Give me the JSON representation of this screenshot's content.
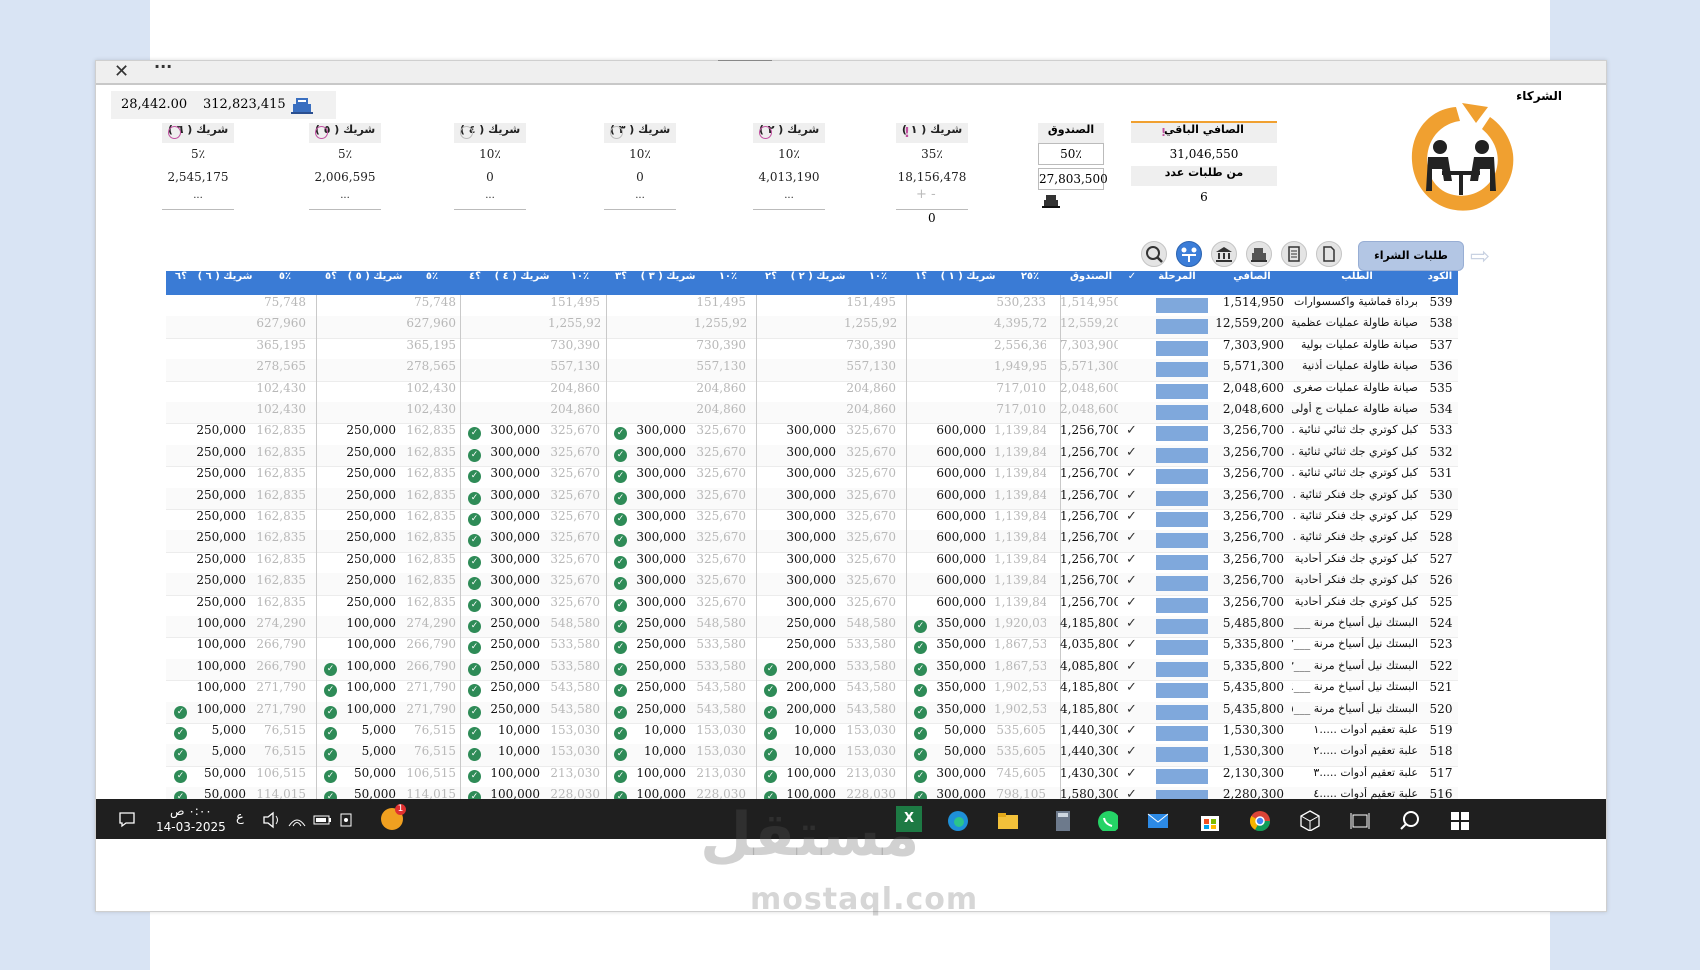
{
  "window": {
    "close_icon": "close-icon",
    "more_label": "···"
  },
  "header": {
    "title": "الشركاء",
    "totals": {
      "value_a": "28,442.00",
      "value_b": "312,823,415"
    },
    "net": {
      "label": "الصافي الباقي",
      "value": "31,046,550",
      "count_label": "من طلبات عدد",
      "count": "6"
    },
    "fund": {
      "label": "الصندوق",
      "percent": "50٪",
      "value": "27,803,500"
    },
    "partners": [
      {
        "label": "شريك ( ١ )",
        "percent": "35٪",
        "value": "18,156,478",
        "extra": "0"
      },
      {
        "label": "شريك ( ٢ )",
        "percent": "10٪",
        "value": "4,013,190",
        "extra": "..."
      },
      {
        "label": "شريك ( ٣ )",
        "percent": "10٪",
        "value": "0",
        "extra": "..."
      },
      {
        "label": "شريك ( ٤ )",
        "percent": "10٪",
        "value": "0",
        "extra": "..."
      },
      {
        "label": "شريك ( ٥ )",
        "percent": "5٪",
        "value": "2,006,595",
        "extra": "..."
      },
      {
        "label": "شريك ( ٦ )",
        "percent": "5٪",
        "value": "2,545,175",
        "extra": "..."
      }
    ],
    "plusminus": "+ -"
  },
  "toolbar": {
    "orders_label": "طلبات الشراء"
  },
  "table": {
    "headers": {
      "code": "الكود",
      "req": "الطلب",
      "net": "الصافي",
      "stage": "المرحلة",
      "chk": "✓",
      "fund": "الصندوق",
      "p1pct": "٪٢٥",
      "p1": "شريك ( ١ )",
      "p1f": "؟١",
      "p2pct": "٪١٠",
      "p2": "شريك ( ٢ )",
      "p2f": "؟٢",
      "p3pct": "٪١٠",
      "p3": "شريك ( ٣ )",
      "p3f": "؟٣",
      "p4pct": "٪١٠",
      "p4": "شريك ( ٤ )",
      "p4f": "؟٤",
      "p5pct": "٪٥",
      "p5": "شريك ( ٥ )",
      "p5f": "؟٥",
      "p6pct": "٪٥",
      "p6": "شريك ( ٦ )",
      "p6f": "؟٦"
    },
    "rows": [
      {
        "code": "539",
        "req": "برداة قماشية واكسسوارات",
        "net": "1,514,950",
        "fund": "1,514,950",
        "p1l": "530,233",
        "p2l": "151,495",
        "p3l": "151,495",
        "p4l": "151,495",
        "p5l": "75,748",
        "p6l": "75,748",
        "light": true
      },
      {
        "code": "538",
        "req": "صيانة طاولة عمليات عظمية",
        "net": "12,559,200",
        "fund": "12,559,200",
        "p1l": "4,395,720",
        "p2l": "1,255,920",
        "p3l": "1,255,920",
        "p4l": "1,255,920",
        "p5l": "627,960",
        "p6l": "627,960",
        "light": true
      },
      {
        "code": "537",
        "req": "صيانة طاولة عمليات بولية",
        "net": "7,303,900",
        "fund": "7,303,900",
        "p1l": "2,556,365",
        "p2l": "730,390",
        "p3l": "730,390",
        "p4l": "730,390",
        "p5l": "365,195",
        "p6l": "365,195",
        "light": true
      },
      {
        "code": "536",
        "req": "صيانة طاولة عمليات أذنية",
        "net": "5,571,300",
        "fund": "5,571,300",
        "p1l": "1,949,955",
        "p2l": "557,130",
        "p3l": "557,130",
        "p4l": "557,130",
        "p5l": "278,565",
        "p6l": "278,565",
        "light": true
      },
      {
        "code": "535",
        "req": "صيانة طاولة عمليات صغرى",
        "net": "2,048,600",
        "fund": "2,048,600",
        "p1l": "717,010",
        "p2l": "204,860",
        "p3l": "204,860",
        "p4l": "204,860",
        "p5l": "102,430",
        "p6l": "102,430",
        "light": true
      },
      {
        "code": "534",
        "req": "صيانة طاولة عمليات ج أولى",
        "net": "2,048,600",
        "fund": "2,048,600",
        "p1l": "717,010",
        "p2l": "204,860",
        "p3l": "204,860",
        "p4l": "204,860",
        "p5l": "102,430",
        "p6l": "102,430",
        "light": true
      },
      {
        "code": "533",
        "req": "كبل كوتري جك ثنائي ثنائية ...١",
        "net": "3,256,700",
        "fund": "1,256,700",
        "p1l": "1,139,845",
        "p1": "600,000",
        "p2l": "325,670",
        "p2": "300,000",
        "p3l": "325,670",
        "p3": "300,000",
        "p3f": true,
        "p4l": "325,670",
        "p4": "300,000",
        "p4f": true,
        "p5l": "162,835",
        "p5": "250,000",
        "p6l": "162,835",
        "p6": "250,000",
        "chk": true
      },
      {
        "code": "532",
        "req": "كبل كوتري جك ثنائي ثنائية ...٢",
        "net": "3,256,700",
        "fund": "1,256,700",
        "p1l": "1,139,845",
        "p1": "600,000",
        "p2l": "325,670",
        "p2": "300,000",
        "p3l": "325,670",
        "p3": "300,000",
        "p3f": true,
        "p4l": "325,670",
        "p4": "300,000",
        "p4f": true,
        "p5l": "162,835",
        "p5": "250,000",
        "p6l": "162,835",
        "p6": "250,000",
        "chk": true
      },
      {
        "code": "531",
        "req": "كبل كوتري جك ثنائي ثنائية ...٣",
        "net": "3,256,700",
        "fund": "1,256,700",
        "p1l": "1,139,845",
        "p1": "600,000",
        "p2l": "325,670",
        "p2": "300,000",
        "p3l": "325,670",
        "p3": "300,000",
        "p3f": true,
        "p4l": "325,670",
        "p4": "300,000",
        "p4f": true,
        "p5l": "162,835",
        "p5": "250,000",
        "p6l": "162,835",
        "p6": "250,000",
        "chk": true
      },
      {
        "code": "530",
        "req": "كبل كوتري جك فنكر ثنائية ...١",
        "net": "3,256,700",
        "fund": "1,256,700",
        "p1l": "1,139,845",
        "p1": "600,000",
        "p2l": "325,670",
        "p2": "300,000",
        "p3l": "325,670",
        "p3": "300,000",
        "p3f": true,
        "p4l": "325,670",
        "p4": "300,000",
        "p4f": true,
        "p5l": "162,835",
        "p5": "250,000",
        "p6l": "162,835",
        "p6": "250,000",
        "chk": true
      },
      {
        "code": "529",
        "req": "كبل كوتري جك فنكر ثنائية ...٢",
        "net": "3,256,700",
        "fund": "1,256,700",
        "p1l": "1,139,845",
        "p1": "600,000",
        "p2l": "325,670",
        "p2": "300,000",
        "p3l": "325,670",
        "p3": "300,000",
        "p3f": true,
        "p4l": "325,670",
        "p4": "300,000",
        "p4f": true,
        "p5l": "162,835",
        "p5": "250,000",
        "p6l": "162,835",
        "p6": "250,000",
        "chk": true
      },
      {
        "code": "528",
        "req": "كبل كوتري جك فنكر ثنائية ...٣",
        "net": "3,256,700",
        "fund": "1,256,700",
        "p1l": "1,139,845",
        "p1": "600,000",
        "p2l": "325,670",
        "p2": "300,000",
        "p3l": "325,670",
        "p3": "300,000",
        "p3f": true,
        "p4l": "325,670",
        "p4": "300,000",
        "p4f": true,
        "p5l": "162,835",
        "p5": "250,000",
        "p6l": "162,835",
        "p6": "250,000",
        "chk": true
      },
      {
        "code": "527",
        "req": "كبل كوتري جك فنكر أحادية ...١",
        "net": "3,256,700",
        "fund": "1,256,700",
        "p1l": "1,139,845",
        "p1": "600,000",
        "p2l": "325,670",
        "p2": "300,000",
        "p3l": "325,670",
        "p3": "300,000",
        "p3f": true,
        "p4l": "325,670",
        "p4": "300,000",
        "p4f": true,
        "p5l": "162,835",
        "p5": "250,000",
        "p6l": "162,835",
        "p6": "250,000",
        "chk": true
      },
      {
        "code": "526",
        "req": "كبل كوتري جك فنكر أحادية ...٢",
        "net": "3,256,700",
        "fund": "1,256,700",
        "p1l": "1,139,845",
        "p1": "600,000",
        "p2l": "325,670",
        "p2": "300,000",
        "p3l": "325,670",
        "p3": "300,000",
        "p3f": true,
        "p4l": "325,670",
        "p4": "300,000",
        "p4f": true,
        "p5l": "162,835",
        "p5": "250,000",
        "p6l": "162,835",
        "p6": "250,000",
        "chk": true
      },
      {
        "code": "525",
        "req": "كبل كوتري جك فنكر أحادية ...٣",
        "net": "3,256,700",
        "fund": "1,256,700",
        "p1l": "1,139,845",
        "p1": "600,000",
        "p2l": "325,670",
        "p2": "300,000",
        "p3l": "325,670",
        "p3": "300,000",
        "p3f": true,
        "p4l": "325,670",
        "p4": "300,000",
        "p4f": true,
        "p5l": "162,835",
        "p5": "250,000",
        "p6l": "162,835",
        "p6": "250,000",
        "chk": true
      },
      {
        "code": "524",
        "req": "البستك نيل أسياخ مرنة ___١",
        "net": "5,485,800",
        "fund": "4,185,800",
        "p1l": "1,920,030",
        "p1": "350,000",
        "p1f": true,
        "p2l": "548,580",
        "p2": "250,000",
        "p3l": "548,580",
        "p3": "250,000",
        "p3f": true,
        "p4l": "548,580",
        "p4": "250,000",
        "p4f": true,
        "p5l": "274,290",
        "p5": "100,000",
        "p6l": "274,290",
        "p6": "100,000",
        "chk": true
      },
      {
        "code": "523",
        "req": "البستك نيل أسياخ مرنة ___٢",
        "net": "5,335,800",
        "fund": "4,035,800",
        "p1l": "1,867,530",
        "p1": "350,000",
        "p1f": true,
        "p2l": "533,580",
        "p2": "250,000",
        "p3l": "533,580",
        "p3": "250,000",
        "p3f": true,
        "p4l": "533,580",
        "p4": "250,000",
        "p4f": true,
        "p5l": "266,790",
        "p5": "100,000",
        "p6l": "266,790",
        "p6": "100,000",
        "chk": true
      },
      {
        "code": "522",
        "req": "البستك نيل أسياخ مرنة ___٣",
        "net": "5,335,800",
        "fund": "4,085,800",
        "p1l": "1,867,530",
        "p1": "350,000",
        "p1f": true,
        "p2l": "533,580",
        "p2": "200,000",
        "p2f": true,
        "p3l": "533,580",
        "p3": "250,000",
        "p3f": true,
        "p4l": "533,580",
        "p4": "250,000",
        "p4f": true,
        "p5l": "266,790",
        "p5": "100,000",
        "p5f": true,
        "p6l": "266,790",
        "p6": "100,000",
        "chk": true
      },
      {
        "code": "521",
        "req": "البستك نيل أسياخ مرنة ___٤",
        "net": "5,435,800",
        "fund": "4,185,800",
        "p1l": "1,902,530",
        "p1": "350,000",
        "p1f": true,
        "p2l": "543,580",
        "p2": "200,000",
        "p2f": true,
        "p3l": "543,580",
        "p3": "250,000",
        "p3f": true,
        "p4l": "543,580",
        "p4": "250,000",
        "p4f": true,
        "p5l": "271,790",
        "p5": "100,000",
        "p5f": true,
        "p6l": "271,790",
        "p6": "100,000",
        "chk": true
      },
      {
        "code": "520",
        "req": "البستك نيل أسياخ مرنة ___٥",
        "net": "5,435,800",
        "fund": "4,185,800",
        "p1l": "1,902,530",
        "p1": "350,000",
        "p1f": true,
        "p2l": "543,580",
        "p2": "200,000",
        "p2f": true,
        "p3l": "543,580",
        "p3": "250,000",
        "p3f": true,
        "p4l": "543,580",
        "p4": "250,000",
        "p4f": true,
        "p5l": "271,790",
        "p5": "100,000",
        "p5f": true,
        "p6l": "271,790",
        "p6": "100,000",
        "p6f": true,
        "chk": true
      },
      {
        "code": "519",
        "req": "علبة تعقيم أدوات .....١",
        "net": "1,530,300",
        "fund": "1,440,300",
        "p1l": "535,605",
        "p1": "50,000",
        "p1f": true,
        "p2l": "153,030",
        "p2": "10,000",
        "p2f": true,
        "p3l": "153,030",
        "p3": "10,000",
        "p3f": true,
        "p4l": "153,030",
        "p4": "10,000",
        "p4f": true,
        "p5l": "76,515",
        "p5": "5,000",
        "p5f": true,
        "p6l": "76,515",
        "p6": "5,000",
        "p6f": true,
        "chk": true
      },
      {
        "code": "518",
        "req": "علبة تعقيم أدوات .....٢",
        "net": "1,530,300",
        "fund": "1,440,300",
        "p1l": "535,605",
        "p1": "50,000",
        "p1f": true,
        "p2l": "153,030",
        "p2": "10,000",
        "p2f": true,
        "p3l": "153,030",
        "p3": "10,000",
        "p3f": true,
        "p4l": "153,030",
        "p4": "10,000",
        "p4f": true,
        "p5l": "76,515",
        "p5": "5,000",
        "p5f": true,
        "p6l": "76,515",
        "p6": "5,000",
        "p6f": true,
        "chk": true
      },
      {
        "code": "517",
        "req": "علبة تعقيم أدوات .....٣",
        "net": "2,130,300",
        "fund": "1,430,300",
        "p1l": "745,605",
        "p1": "300,000",
        "p1f": true,
        "p2l": "213,030",
        "p2": "100,000",
        "p2f": true,
        "p3l": "213,030",
        "p3": "100,000",
        "p3f": true,
        "p4l": "213,030",
        "p4": "100,000",
        "p4f": true,
        "p5l": "106,515",
        "p5": "50,000",
        "p5f": true,
        "p6l": "106,515",
        "p6": "50,000",
        "p6f": true,
        "chk": true
      },
      {
        "code": "516",
        "req": "علبة تعقيم أدوات .....٤",
        "net": "2,280,300",
        "fund": "1,580,300",
        "p1l": "798,105",
        "p1": "300,000",
        "p1f": true,
        "p2l": "228,030",
        "p2": "100,000",
        "p2f": true,
        "p3l": "228,030",
        "p3": "100,000",
        "p3f": true,
        "p4l": "228,030",
        "p4": "100,000",
        "p4f": true,
        "p5l": "114,015",
        "p5": "50,000",
        "p5f": true,
        "p6l": "114,015",
        "p6": "50,000",
        "p6f": true,
        "chk": true
      }
    ]
  },
  "taskbar": {
    "time": "٠:٠٠ ص",
    "date": "14-03-2025",
    "lang": "ع",
    "badge": "1"
  },
  "watermark": {
    "ar": "مستقل",
    "en": "mostaql.com"
  },
  "colors": {
    "header_blue": "#3a7bd5",
    "bar_blue": "#7fa8dc",
    "ok_green": "#2e8b57",
    "logo_orange": "#f0a030"
  }
}
